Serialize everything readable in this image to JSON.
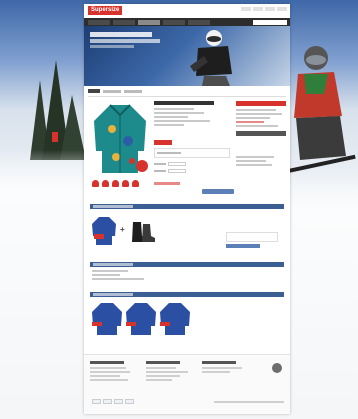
{
  "brand": {
    "logo_text": "Supersize",
    "accent": "#d8322c",
    "nav_bg": "#2d2d2d",
    "link_blue": "#3b5e93"
  },
  "header": {
    "top_links": [
      "",
      "",
      "",
      ""
    ],
    "nav": [
      {
        "label": ""
      },
      {
        "label": ""
      },
      {
        "label": ""
      },
      {
        "label": ""
      },
      {
        "label": ""
      }
    ],
    "search_placeholder": ""
  },
  "hero": {
    "headline": "",
    "subline": ""
  },
  "breadcrumb": [
    "",
    "",
    ""
  ],
  "product": {
    "title": "",
    "price": "",
    "promo_label": "",
    "color_label": "",
    "size_label": "",
    "add_to_cart": ""
  },
  "sidebar": {
    "heading": "",
    "note": ""
  },
  "bundle": {
    "heading": "",
    "price": "",
    "cta": ""
  },
  "description": {
    "heading": ""
  },
  "recommendations": {
    "heading": "",
    "items": [
      {
        "name": ""
      },
      {
        "name": ""
      },
      {
        "name": ""
      }
    ]
  },
  "footer": {
    "columns": [
      {
        "heading": ""
      },
      {
        "heading": ""
      },
      {
        "heading": ""
      }
    ],
    "legal": ""
  },
  "icons": [
    "skier-icon",
    "jacket-icon",
    "boots-icon",
    "beanie-icon",
    "payment-card-icon",
    "trust-badge-icon"
  ]
}
